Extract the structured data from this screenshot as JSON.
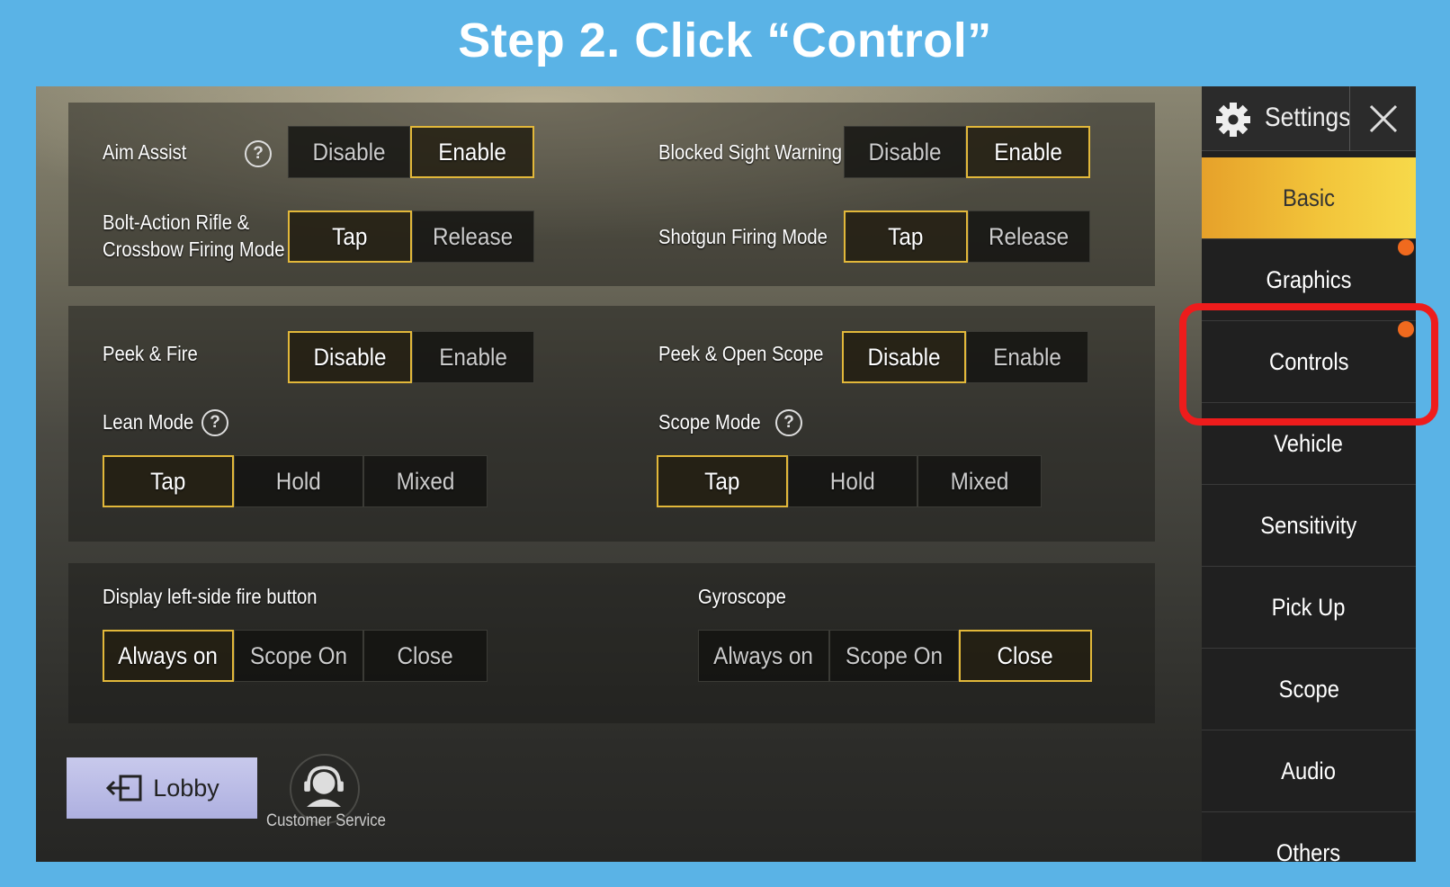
{
  "instruction": "Step 2. Click “Control”",
  "panel_top": {
    "aim_assist": {
      "label": "Aim Assist",
      "options": [
        "Disable",
        "Enable"
      ],
      "selected": "Enable"
    },
    "blocked_sight": {
      "label": "Blocked Sight Warning",
      "options": [
        "Disable",
        "Enable"
      ],
      "selected": "Enable"
    },
    "bolt_action": {
      "label_line1": "Bolt-Action Rifle &",
      "label_line2": "Crossbow Firing Mode",
      "options": [
        "Tap",
        "Release"
      ],
      "selected": "Tap"
    },
    "shotgun": {
      "label": "Shotgun Firing Mode",
      "options": [
        "Tap",
        "Release"
      ],
      "selected": "Tap"
    }
  },
  "panel_mid": {
    "peek_fire": {
      "label": "Peek & Fire",
      "options": [
        "Disable",
        "Enable"
      ],
      "selected": "Disable"
    },
    "peek_scope": {
      "label": "Peek & Open Scope",
      "options": [
        "Disable",
        "Enable"
      ],
      "selected": "Disable"
    },
    "lean_mode": {
      "label": "Lean Mode",
      "options": [
        "Tap",
        "Hold",
        "Mixed"
      ],
      "selected": "Tap"
    },
    "scope_mode": {
      "label": "Scope Mode",
      "options": [
        "Tap",
        "Hold",
        "Mixed"
      ],
      "selected": "Tap"
    }
  },
  "panel_bottom": {
    "left_fire": {
      "label": "Display left-side fire button",
      "options": [
        "Always on",
        "Scope On",
        "Close"
      ],
      "selected": "Always on"
    },
    "gyroscope": {
      "label": "Gyroscope",
      "options": [
        "Always on",
        "Scope On",
        "Close"
      ],
      "selected": "Close"
    }
  },
  "sidebar": {
    "title": "Settings",
    "items": [
      {
        "label": "Basic",
        "active": true,
        "dot": false
      },
      {
        "label": "Graphics",
        "active": false,
        "dot": true
      },
      {
        "label": "Controls",
        "active": false,
        "dot": true
      },
      {
        "label": "Vehicle",
        "active": false,
        "dot": false
      },
      {
        "label": "Sensitivity",
        "active": false,
        "dot": false
      },
      {
        "label": "Pick Up",
        "active": false,
        "dot": false
      },
      {
        "label": "Scope",
        "active": false,
        "dot": false
      },
      {
        "label": "Audio",
        "active": false,
        "dot": false
      },
      {
        "label": "Others",
        "active": false,
        "dot": false
      }
    ]
  },
  "footer": {
    "lobby_label": "Lobby",
    "customer_service_label": "Customer Service"
  },
  "colors": {
    "background": "#5ab3e6",
    "accent_gold": "#e2b83a",
    "active_tab": "#f2c43a",
    "highlight_red": "#ee1c1c",
    "notification_dot": "#f06a1e"
  }
}
